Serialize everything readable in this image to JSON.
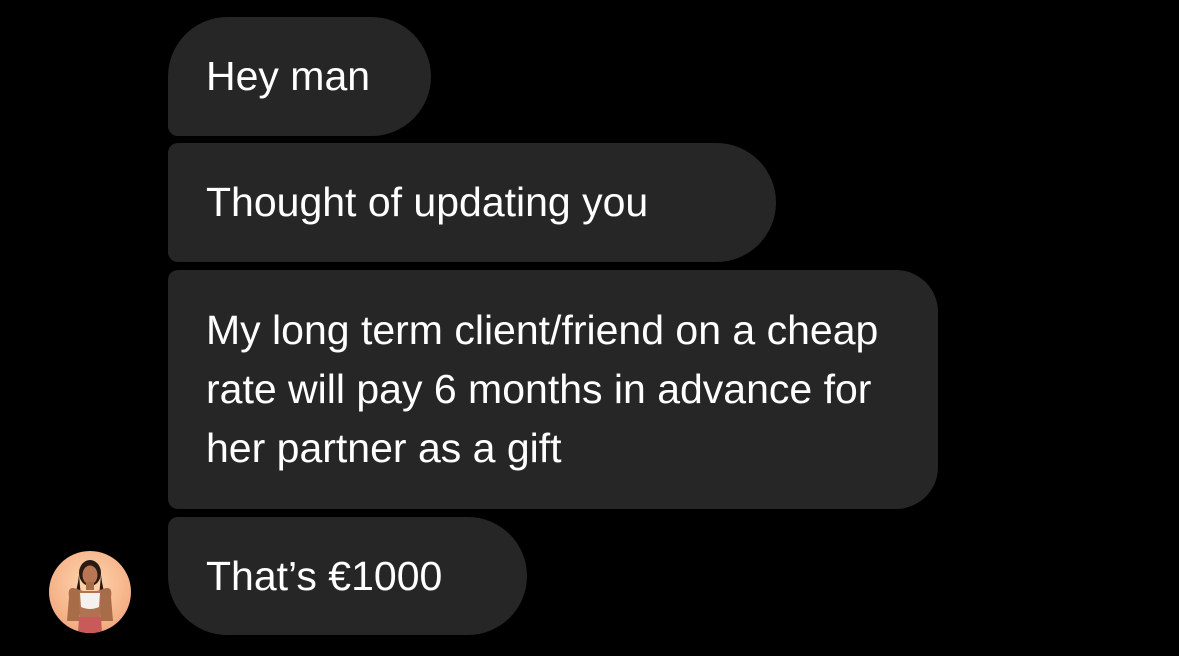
{
  "conversation": {
    "messages": [
      {
        "text": "Hey man"
      },
      {
        "text": "Thought of updating you"
      },
      {
        "text": "My long term client/friend on a cheap rate will pay 6 months in advance for her partner as a gift"
      },
      {
        "text": "That’s €1000"
      }
    ]
  },
  "sender": {
    "avatar_icon": "profile-photo-icon"
  },
  "colors": {
    "background": "#000000",
    "bubble": "#262626",
    "text": "#ffffff"
  }
}
